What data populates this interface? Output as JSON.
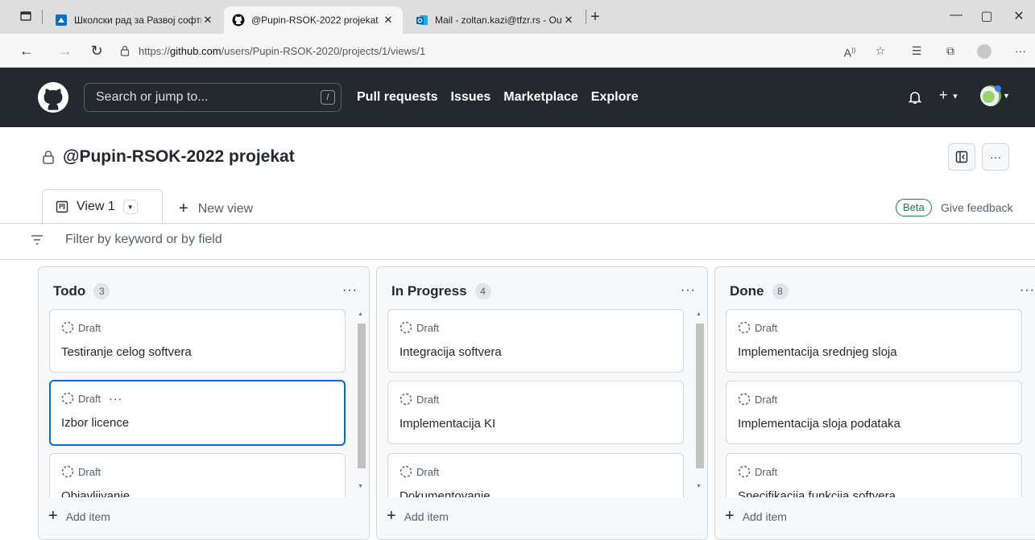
{
  "browser": {
    "tabs": [
      {
        "title": "Школски рад за Развој софтвер",
        "icon": "blue-school-icon"
      },
      {
        "title": "@Pupin-RSOK-2022 projekat",
        "icon": "github-icon"
      },
      {
        "title": "Mail - zoltan.kazi@tfzr.rs - Outlo",
        "icon": "outlook-icon"
      }
    ],
    "url_prefix": "https://",
    "url_host": "github.com",
    "url_path": "/users/Pupin-RSOK-2020/projects/1/views/1"
  },
  "github": {
    "search_placeholder": "Search or jump to...",
    "search_key": "/",
    "nav": [
      "Pull requests",
      "Issues",
      "Marketplace",
      "Explore"
    ]
  },
  "project": {
    "title": "@Pupin-RSOK-2022 projekat",
    "view_tab": "View 1",
    "new_view": "New view",
    "beta": "Beta",
    "feedback": "Give feedback",
    "filter_placeholder": "Filter by keyword or by field",
    "add_item": "Add item",
    "draft_label": "Draft",
    "columns": [
      {
        "name": "Todo",
        "count": "3",
        "cards": [
          "Testiranje celog softvera",
          "Izbor licence",
          "Objavljivanje"
        ]
      },
      {
        "name": "In Progress",
        "count": "4",
        "cards": [
          "Integracija softvera",
          "Implementacija KI",
          "Dokumentovanje"
        ]
      },
      {
        "name": "Done",
        "count": "8",
        "cards": [
          "Implementacija srednjeg sloja",
          "Implementacija sloja podataka",
          "Specifikacija funkcija softvera"
        ]
      }
    ],
    "selected_card": "Izbor licence"
  },
  "colors": {
    "header_bg": "#24292f",
    "accent_blue": "#0969da",
    "beta_green": "#1a7f37"
  }
}
